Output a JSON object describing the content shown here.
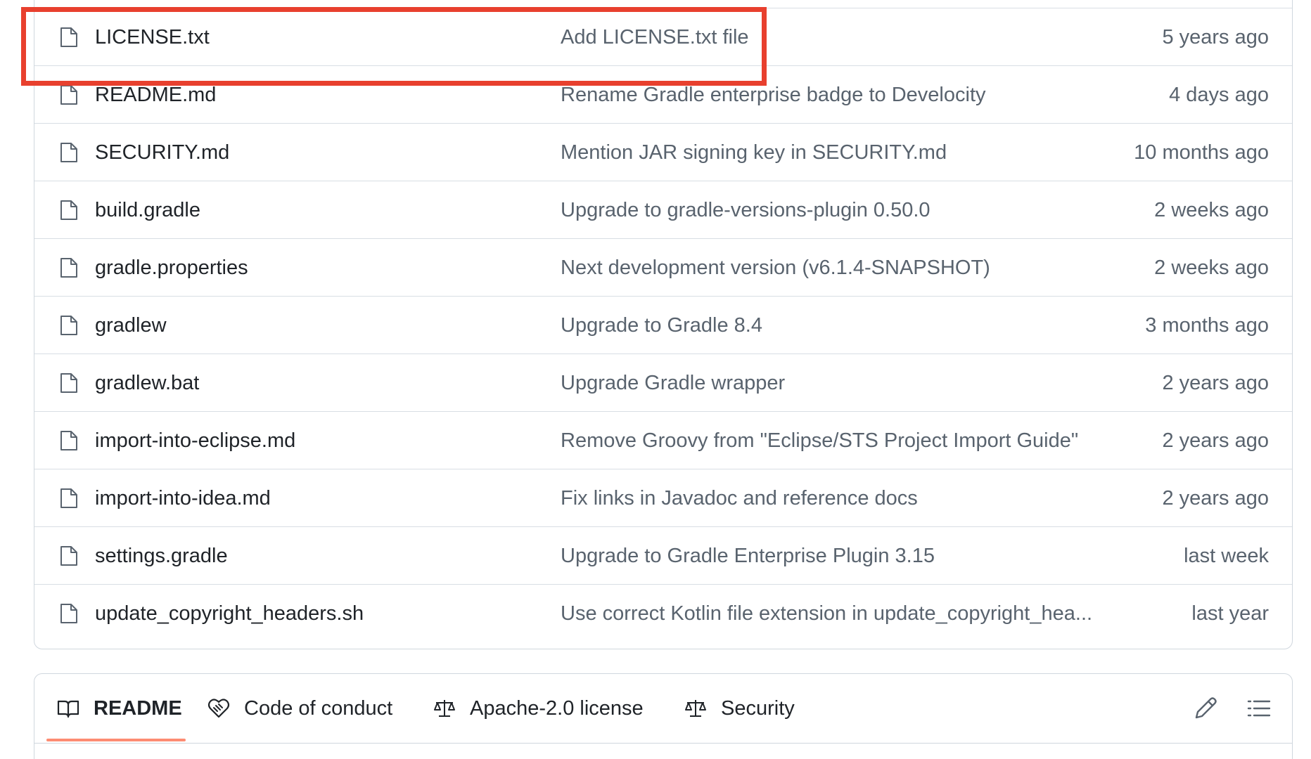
{
  "files": [
    {
      "name": "LICENSE.txt",
      "commit": "Add LICENSE.txt file",
      "age": "5 years ago"
    },
    {
      "name": "README.md",
      "commit": "Rename Gradle enterprise badge to Develocity",
      "age": "4 days ago"
    },
    {
      "name": "SECURITY.md",
      "commit": "Mention JAR signing key in SECURITY.md",
      "age": "10 months ago"
    },
    {
      "name": "build.gradle",
      "commit": "Upgrade to gradle-versions-plugin 0.50.0",
      "age": "2 weeks ago"
    },
    {
      "name": "gradle.properties",
      "commit": "Next development version (v6.1.4-SNAPSHOT)",
      "age": "2 weeks ago"
    },
    {
      "name": "gradlew",
      "commit": "Upgrade to Gradle 8.4",
      "age": "3 months ago"
    },
    {
      "name": "gradlew.bat",
      "commit": "Upgrade Gradle wrapper",
      "age": "2 years ago"
    },
    {
      "name": "import-into-eclipse.md",
      "commit": "Remove Groovy from \"Eclipse/STS Project Import Guide\"",
      "age": "2 years ago"
    },
    {
      "name": "import-into-idea.md",
      "commit": "Fix links in Javadoc and reference docs",
      "age": "2 years ago"
    },
    {
      "name": "settings.gradle",
      "commit": "Upgrade to Gradle Enterprise Plugin 3.15",
      "age": "last week"
    },
    {
      "name": "update_copyright_headers.sh",
      "commit": "Use correct Kotlin file extension in update_copyright_hea...",
      "age": "last year"
    }
  ],
  "tabs": [
    {
      "label": "README",
      "icon": "book-icon",
      "active": true
    },
    {
      "label": "Code of conduct",
      "icon": "code-of-conduct-icon",
      "active": false
    },
    {
      "label": "Apache-2.0 license",
      "icon": "law-scale-icon",
      "active": false
    },
    {
      "label": "Security",
      "icon": "law-scale-icon",
      "active": false
    }
  ],
  "toolbar": {
    "edit_icon": "pencil-icon",
    "outline_icon": "list-icon"
  },
  "colors": {
    "highlight": "#e8402e",
    "active_tab_underline": "#fd8c73",
    "muted_text": "#59636e"
  }
}
